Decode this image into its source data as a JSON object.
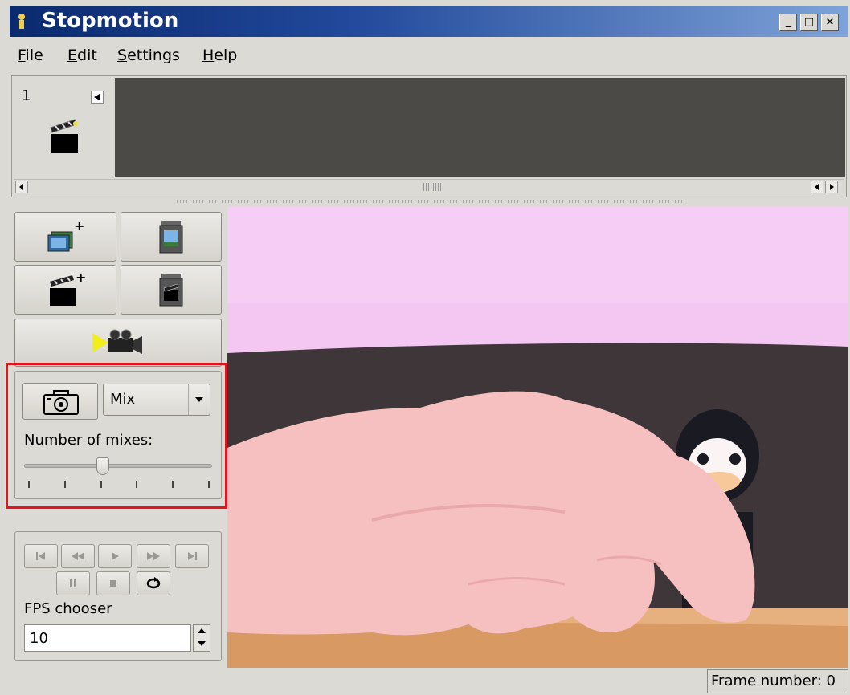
{
  "window": {
    "title": "Stopmotion",
    "minimize_label": "_",
    "maximize_label": "□",
    "close_label": "×"
  },
  "menu": {
    "items": [
      {
        "first": "F",
        "rest": "ile"
      },
      {
        "first": "E",
        "rest": "dit"
      },
      {
        "first": "S",
        "rest": "ettings"
      },
      {
        "first": "H",
        "rest": "elp"
      }
    ]
  },
  "timeline": {
    "frames": [
      {
        "number": "1"
      }
    ]
  },
  "toolbox": {
    "icons": [
      "add-frames-icon",
      "remove-frames-icon",
      "new-scene-icon",
      "remove-scene-icon",
      "video-capture-icon"
    ]
  },
  "mix_panel": {
    "mode_selected": "Mix",
    "mixes_label": "Number of mixes:",
    "mixes_value": 3,
    "mixes_min": 1,
    "mixes_max": 6
  },
  "player": {
    "fps_label": "FPS chooser",
    "fps_value": "10"
  },
  "status": {
    "frame_number": "Frame number: 0"
  },
  "colors": {
    "titlebar": "#0b2a6e",
    "highlight": "#e3141b",
    "timeline_bg": "#4b4a46",
    "window_bg": "#dcdad5"
  }
}
